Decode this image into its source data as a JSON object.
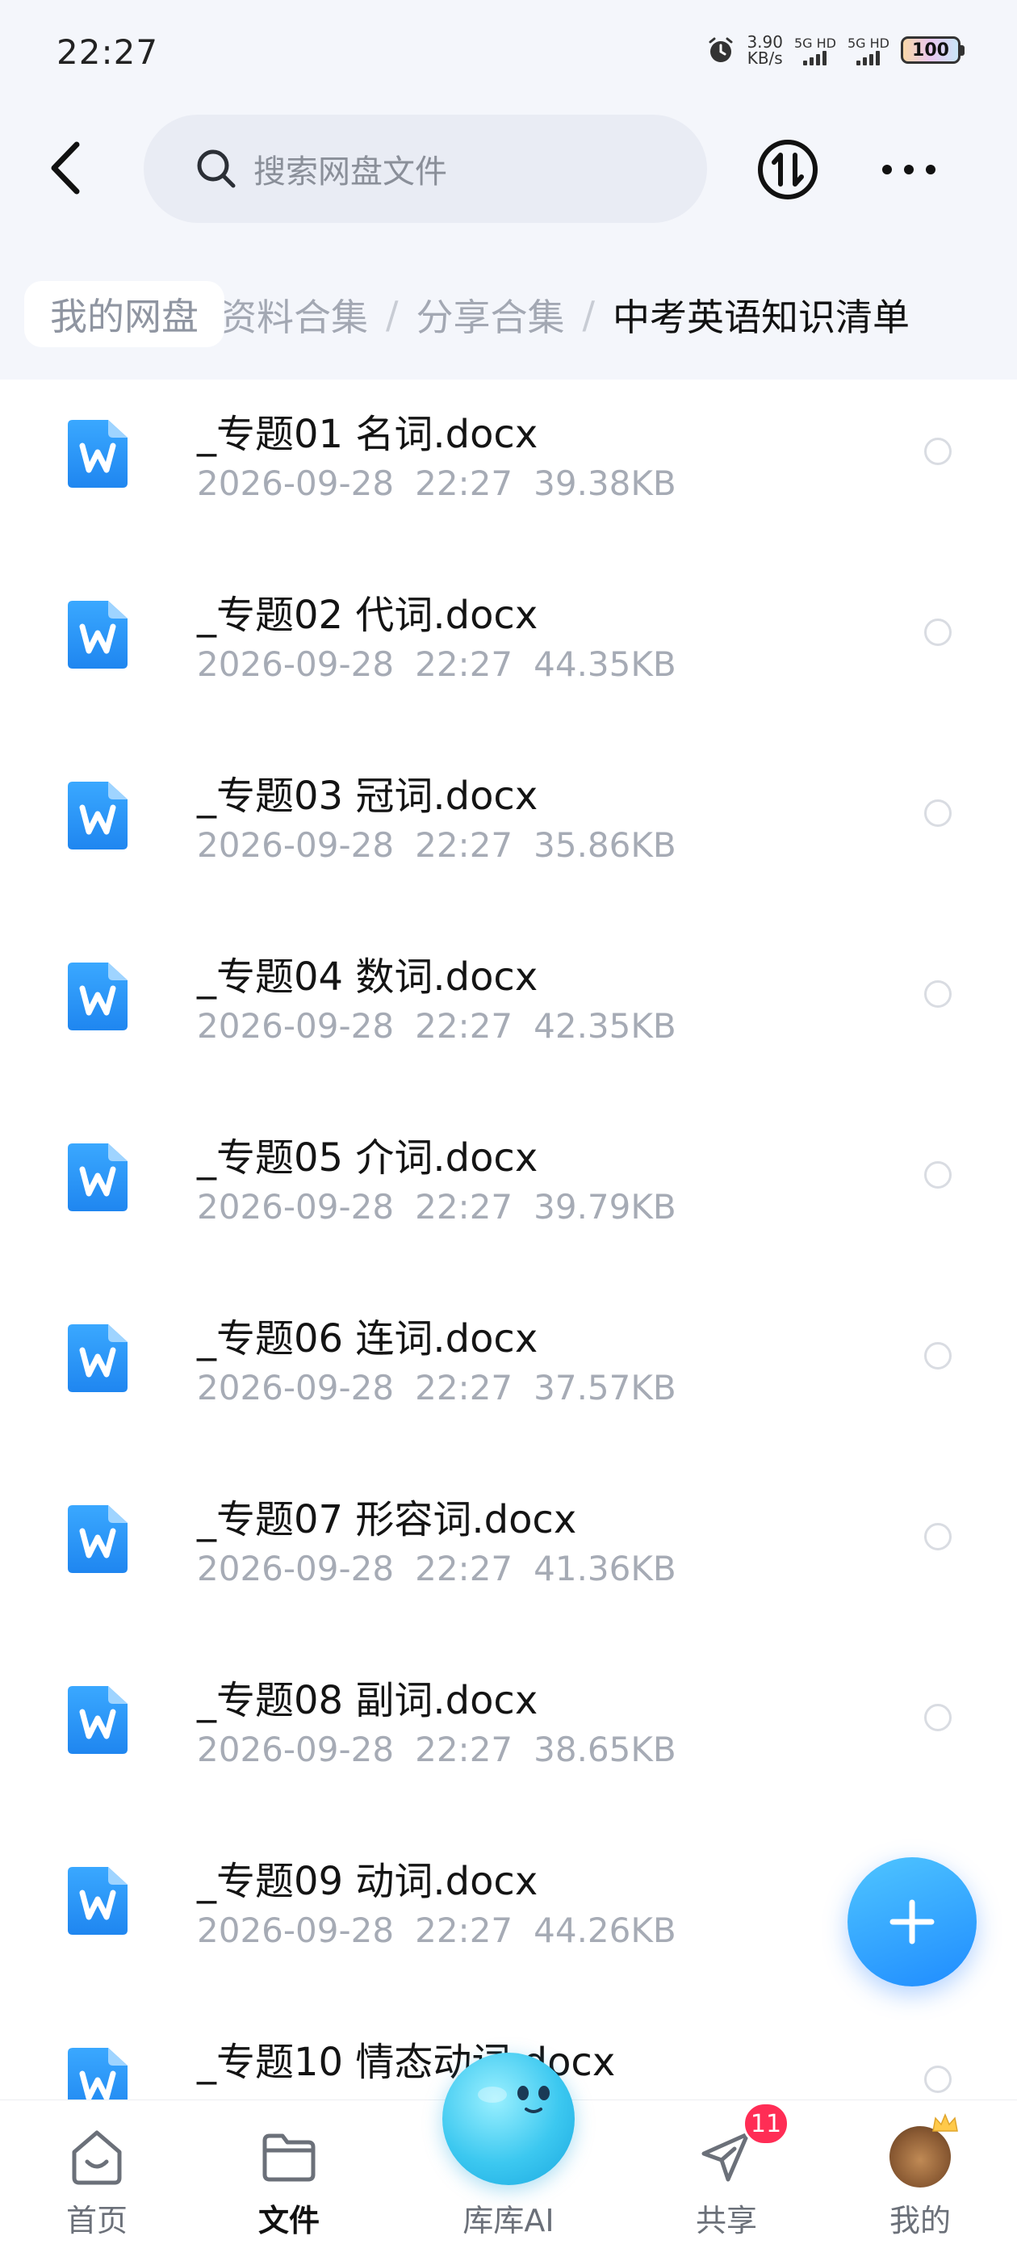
{
  "status_bar": {
    "time": "22:27",
    "net_speed": "3.90",
    "net_unit": "KB/s",
    "signal_1": "5G HD",
    "signal_2": "5G HD",
    "battery": "100"
  },
  "search": {
    "placeholder": "搜索网盘文件"
  },
  "icons": {
    "back": "back-arrow-icon",
    "search": "search-icon",
    "transfer": "transfer-icon",
    "more": "more-icon",
    "file": "word-document-icon",
    "fab": "plus-icon"
  },
  "breadcrumb": {
    "root": "我的网盘",
    "items": [
      "资料合集",
      "分享合集",
      "中考英语知识清单"
    ],
    "separator": "/"
  },
  "files": [
    {
      "name": "_专题01 名词.docx",
      "date": "2026-09-28",
      "time": "22:27",
      "size": "39.38KB"
    },
    {
      "name": "_专题02 代词.docx",
      "date": "2026-09-28",
      "time": "22:27",
      "size": "44.35KB"
    },
    {
      "name": "_专题03 冠词.docx",
      "date": "2026-09-28",
      "time": "22:27",
      "size": "35.86KB"
    },
    {
      "name": "_专题04 数词.docx",
      "date": "2026-09-28",
      "time": "22:27",
      "size": "42.35KB"
    },
    {
      "name": "_专题05 介词.docx",
      "date": "2026-09-28",
      "time": "22:27",
      "size": "39.79KB"
    },
    {
      "name": "_专题06 连词.docx",
      "date": "2026-09-28",
      "time": "22:27",
      "size": "37.57KB"
    },
    {
      "name": "_专题07 形容词.docx",
      "date": "2026-09-28",
      "time": "22:27",
      "size": "41.36KB"
    },
    {
      "name": "_专题08 副词.docx",
      "date": "2026-09-28",
      "time": "22:27",
      "size": "38.65KB"
    },
    {
      "name": "_专题09 动词.docx",
      "date": "2026-09-28",
      "time": "22:27",
      "size": "44.26KB"
    },
    {
      "name": "_专题10 情态动词.docx",
      "date": "",
      "time": "",
      "size": ""
    }
  ],
  "nav": {
    "home": "首页",
    "files": "文件",
    "ai": "库库AI",
    "share": "共享",
    "share_badge": "11",
    "me": "我的",
    "active": "文件"
  },
  "colors": {
    "accent": "#1f8cff",
    "file_icon": "#2e9bf5",
    "badge": "#ff2d55"
  }
}
